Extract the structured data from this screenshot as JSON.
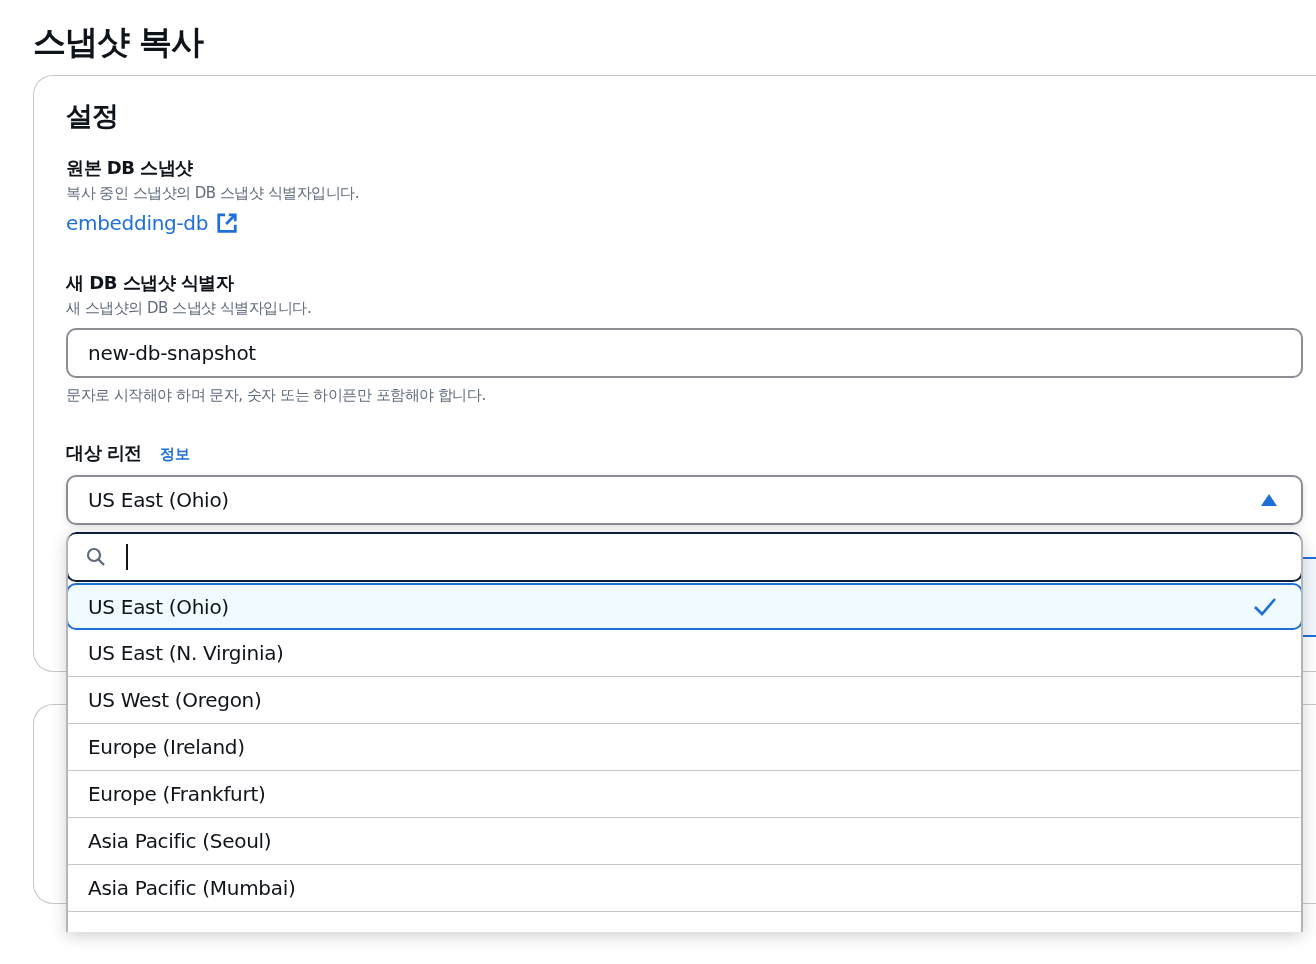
{
  "page_title": "스냅샷 복사",
  "settings": {
    "heading": "설정",
    "source_snapshot": {
      "label": "원본 DB 스냅샷",
      "description": "복사 중인 스냅샷의 DB 스냅샷 식별자입니다.",
      "link": "embedding-db"
    },
    "new_identifier": {
      "label": "새 DB 스냅샷 식별자",
      "description": "새 스냅샷의 DB 스냅샷 식별자입니다.",
      "value": "new-db-snapshot",
      "hint": "문자로 시작해야 하며 문자, 숫자 또는 하이픈만 포함해야 합니다."
    },
    "destination_region": {
      "label": "대상 리전",
      "info_link": "정보",
      "value": "US East (Ohio)",
      "expanded": true,
      "options": [
        {
          "label": "US East (Ohio)",
          "selected": true
        },
        {
          "label": "US East (N. Virginia)",
          "selected": false
        },
        {
          "label": "US West (Oregon)",
          "selected": false
        },
        {
          "label": "Europe (Ireland)",
          "selected": false
        },
        {
          "label": "Europe (Frankfurt)",
          "selected": false
        },
        {
          "label": "Asia Pacific (Seoul)",
          "selected": false
        },
        {
          "label": "Asia Pacific (Mumbai)",
          "selected": false
        }
      ]
    }
  }
}
